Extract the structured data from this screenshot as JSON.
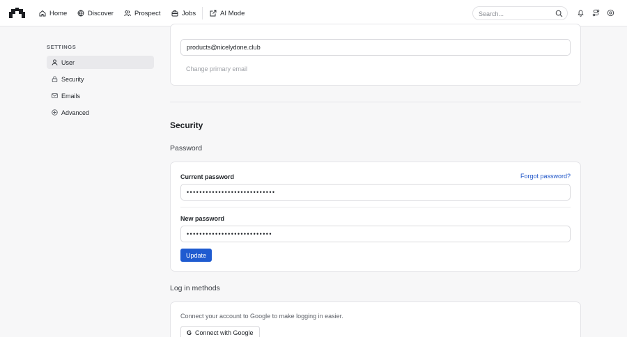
{
  "nav": {
    "items": [
      {
        "label": "Home",
        "icon": "home-icon"
      },
      {
        "label": "Discover",
        "icon": "globe-icon"
      },
      {
        "label": "Prospect",
        "icon": "users-icon"
      },
      {
        "label": "Jobs",
        "icon": "briefcase-icon"
      },
      {
        "label": "AI Mode",
        "icon": "external-link-icon"
      }
    ],
    "search_placeholder": "Search...",
    "right_icons": [
      "bell-icon",
      "route-icon",
      "settings-icon"
    ]
  },
  "sidebar": {
    "heading": "SETTINGS",
    "items": [
      {
        "label": "User",
        "icon": "user-icon",
        "active": true
      },
      {
        "label": "Security",
        "icon": "lock-icon",
        "active": false
      },
      {
        "label": "Emails",
        "icon": "mail-icon",
        "active": false
      },
      {
        "label": "Advanced",
        "icon": "advanced-icon",
        "active": false
      }
    ]
  },
  "email_card": {
    "email_value": "products@nicelydone.club",
    "change_label": "Change primary email"
  },
  "security": {
    "title": "Security",
    "password_heading": "Password",
    "current_label": "Current password",
    "forgot_label": "Forgot password?",
    "current_value": "••••••••••••••••••••••••••••",
    "new_label": "New password",
    "new_value": "•••••••••••••••••••••••••••",
    "update_label": "Update"
  },
  "login_methods": {
    "heading": "Log in methods",
    "help_text": "Connect your account to Google to make logging in easier.",
    "google_label": "Connect with Google",
    "google_glyph": "G"
  },
  "colors": {
    "accent": "#1f5bd0",
    "link": "#1e55c8",
    "background": "#f7f7f8"
  }
}
